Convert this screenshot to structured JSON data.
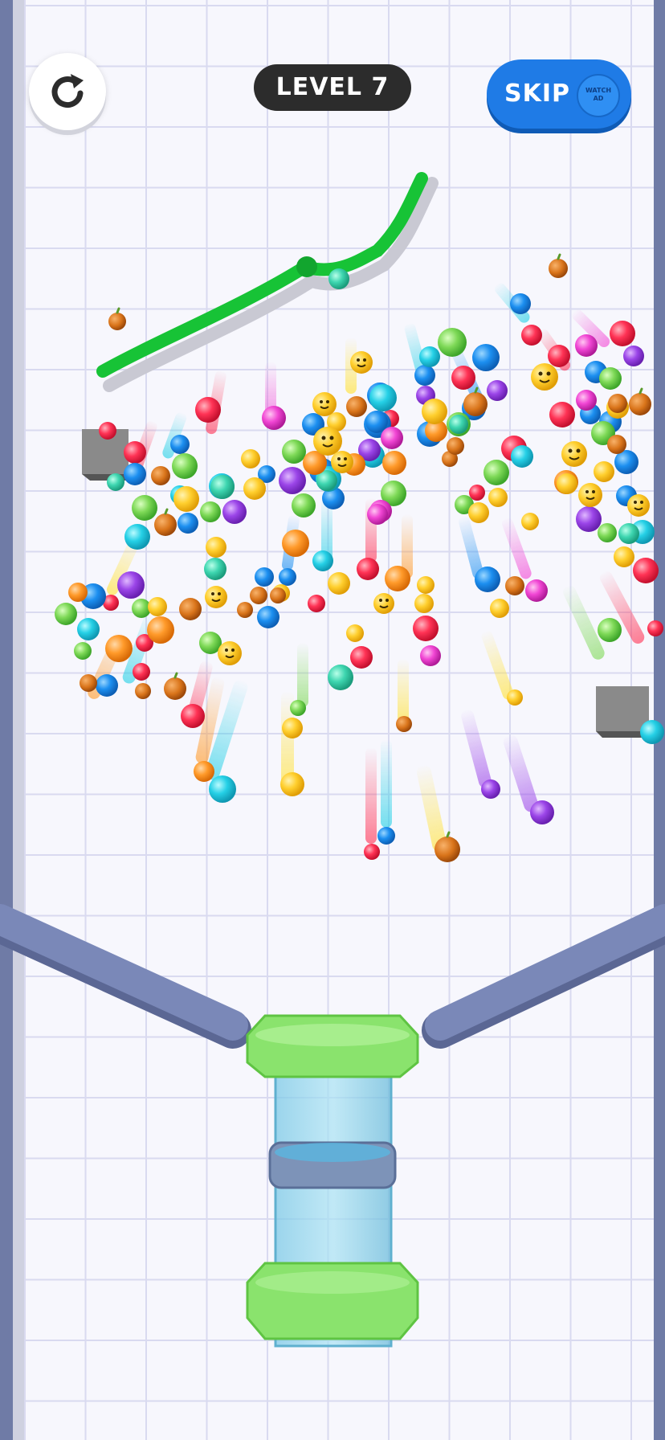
{
  "header": {
    "level_label": "LEVEL 7",
    "skip_label": "SKIP",
    "watch_ad_line1": "WATCH",
    "watch_ad_line2": "AD"
  },
  "icons": {
    "restart": "restart-icon"
  },
  "colors": {
    "drawn_line": "#18c83a",
    "cup_rim": "#7be06a",
    "cup_glass": "#8fd3ec",
    "ramp": "#7a88b8",
    "obstacle": "#8a8a8a",
    "skip_button": "#1f7be6"
  }
}
